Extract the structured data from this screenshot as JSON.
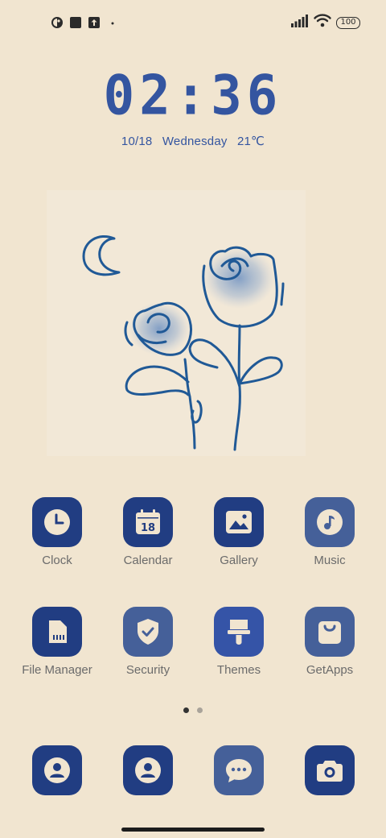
{
  "status_bar": {
    "left_icons": [
      "data-saver-icon",
      "square-notification-icon",
      "upload-notification-icon",
      "more-dot-icon"
    ],
    "right_icons": [
      "signal-bars-icon",
      "wifi-icon"
    ],
    "battery_level": "100"
  },
  "clock_widget": {
    "time": "02:36",
    "date": "10/18",
    "weekday": "Wednesday",
    "temperature": "21℃"
  },
  "wallpaper_art": {
    "subject": "line drawing of two roses and crescent moon"
  },
  "apps": [
    {
      "label": "Clock",
      "icon": "clock-icon",
      "color": "#213d82"
    },
    {
      "label": "Calendar",
      "icon": "calendar-icon",
      "icon_text": "18",
      "color": "#213d82"
    },
    {
      "label": "Gallery",
      "icon": "gallery-icon",
      "color": "#213d82"
    },
    {
      "label": "Music",
      "icon": "music-note-icon",
      "color": "#456099"
    },
    {
      "label": "File Manager",
      "icon": "sd-card-icon",
      "color": "#213d82"
    },
    {
      "label": "Security",
      "icon": "shield-check-icon",
      "color": "#456099"
    },
    {
      "label": "Themes",
      "icon": "paint-brush-icon",
      "color": "#3554a7"
    },
    {
      "label": "GetApps",
      "icon": "shopping-bag-icon",
      "color": "#456099"
    }
  ],
  "page_indicator": {
    "pages": 2,
    "current": 1
  },
  "dock": [
    {
      "icon": "contacts-icon",
      "color": "#213d82"
    },
    {
      "icon": "contacts-icon",
      "color": "#213d82"
    },
    {
      "icon": "messages-icon",
      "color": "#456099"
    },
    {
      "icon": "camera-icon",
      "color": "#213d82"
    }
  ],
  "colors": {
    "background": "#f1e5d0",
    "accent": "#3455a0",
    "icon_dark": "#213d82",
    "icon_mid": "#456099",
    "rose_line": "#205996"
  }
}
